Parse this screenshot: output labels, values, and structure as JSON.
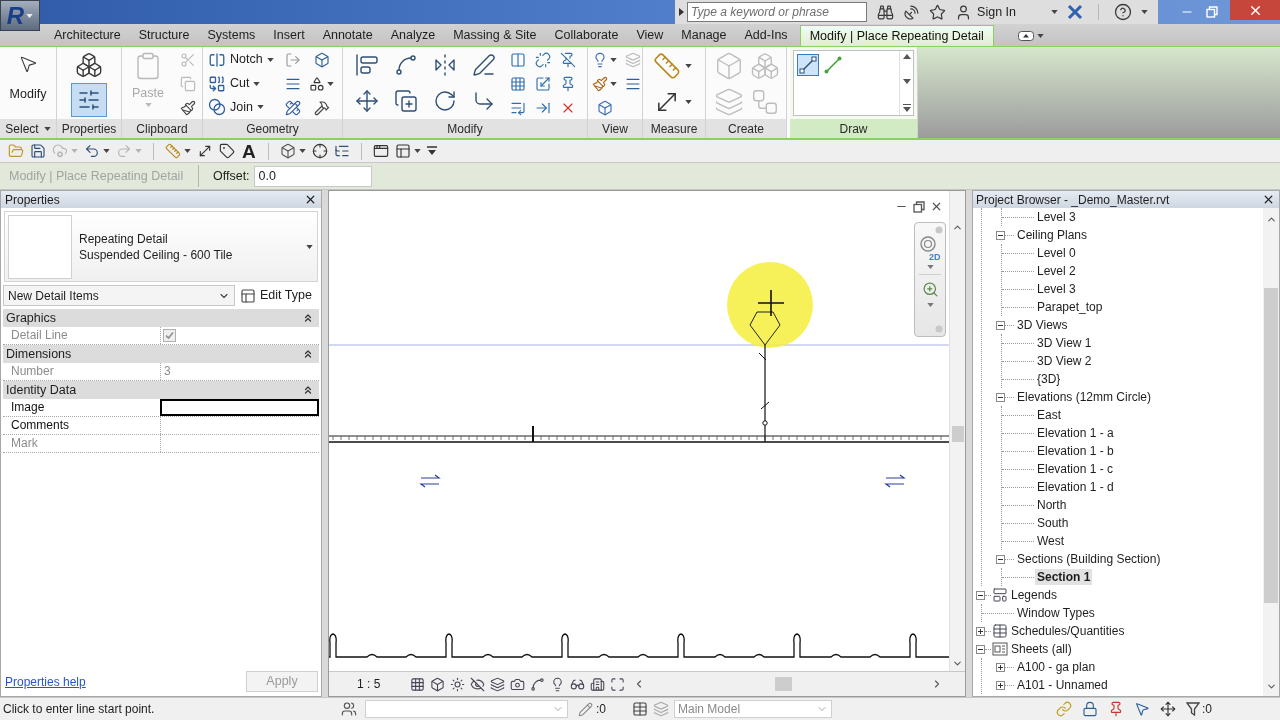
{
  "app_button": {
    "label": "R"
  },
  "title_bar": {
    "search": {
      "placeholder": "Type a keyword or phrase"
    },
    "sign_in": "Sign In"
  },
  "tabs": [
    {
      "label": "Architecture",
      "selected": false
    },
    {
      "label": "Structure",
      "selected": false
    },
    {
      "label": "Systems",
      "selected": false
    },
    {
      "label": "Insert",
      "selected": false
    },
    {
      "label": "Annotate",
      "selected": false
    },
    {
      "label": "Analyze",
      "selected": false
    },
    {
      "label": "Massing & Site",
      "selected": false
    },
    {
      "label": "Collaborate",
      "selected": false
    },
    {
      "label": "View",
      "selected": false
    },
    {
      "label": "Manage",
      "selected": false
    },
    {
      "label": "Add-Ins",
      "selected": false
    },
    {
      "label": "Modify | Place Repeating Detail",
      "selected": true
    }
  ],
  "ribbon": {
    "panels": [
      {
        "kind": "select",
        "label": "Select",
        "tools": [
          {
            "label": "Modify"
          }
        ]
      },
      {
        "kind": "properties",
        "label": "Properties",
        "tools": [
          {
            "selected": false
          },
          {
            "selected": true
          }
        ]
      },
      {
        "kind": "clipboard",
        "label": "Clipboard",
        "tools": [
          {
            "label": "Paste",
            "disabled": true
          },
          {
            "disabled": true
          },
          {
            "disabled": true
          },
          {
            "disabled": false
          }
        ]
      },
      {
        "kind": "geometry",
        "label": "Geometry",
        "tools": [
          {
            "label": "Notch"
          },
          {
            "label": "Cut"
          },
          {
            "label": "Join"
          }
        ]
      },
      {
        "kind": "modify",
        "label": "Modify"
      },
      {
        "kind": "view",
        "label": "View"
      },
      {
        "kind": "measure",
        "label": "Measure"
      },
      {
        "kind": "create",
        "label": "Create",
        "tools": [
          {
            "disabled": true
          },
          {
            "disabled": true
          },
          {
            "disabled": true
          },
          {
            "disabled": true
          }
        ]
      },
      {
        "kind": "draw",
        "label": "Draw",
        "tools": [
          {
            "selected": true
          },
          {
            "selected": false
          }
        ]
      }
    ]
  },
  "quick_access": [
    {
      "disabled": false
    },
    {
      "disabled": false
    },
    {
      "disabled": true
    },
    {
      "disabled": false
    },
    {
      "disabled": true
    },
    {
      "disabled": false
    },
    {
      "disabled": false
    },
    {
      "disabled": false
    },
    {
      "label": "A",
      "disabled": false
    },
    {
      "disabled": false
    },
    {
      "disabled": false
    },
    {
      "disabled": false
    },
    {
      "disabled": false
    },
    {
      "disabled": false
    },
    {
      "disabled": false
    }
  ],
  "options_bar": {
    "mode": "Modify | Place Repeating Detail",
    "offset": {
      "label": "Offset:",
      "value": "0.0"
    }
  },
  "properties": {
    "title": "Properties",
    "type_selector": {
      "family": "Repeating Detail",
      "type": "Suspended Ceiling - 600 Tile"
    },
    "instance_filter": "New Detail Items",
    "edit_type": "Edit Type",
    "groups": [
      {
        "label": "Graphics",
        "expanded": true,
        "params": [
          {
            "label": "Detail Line",
            "kind": "checkbox",
            "checked": true,
            "disabled": true,
            "focused": false
          }
        ]
      },
      {
        "label": "Dimensions",
        "expanded": true,
        "params": [
          {
            "label": "Number",
            "kind": "text",
            "value": "3",
            "disabled": true,
            "focused": false
          }
        ]
      },
      {
        "label": "Identity Data",
        "expanded": true,
        "params": [
          {
            "label": "Image",
            "kind": "text",
            "disabled": false,
            "focused": true
          },
          {
            "label": "Comments",
            "kind": "text",
            "disabled": false,
            "focused": false
          },
          {
            "label": "Mark",
            "kind": "text",
            "disabled": true,
            "focused": false
          }
        ]
      }
    ],
    "help_link": "Properties help",
    "apply": {
      "label": "Apply",
      "disabled": true
    }
  },
  "view": {
    "navigation_bar": {
      "wheel_badge": "2D"
    },
    "scale": "1 : 5"
  },
  "project_browser": {
    "title": "Project Browser - _Demo_Master.rvt",
    "tree": [
      {
        "children": [
          {
            "children": [
              {
                "label": "Level 3",
                "selected": false
              }
            ]
          },
          {
            "label": "Ceiling Plans",
            "expanded": true,
            "selected": false,
            "children": [
              {
                "label": "Level 0",
                "selected": false
              },
              {
                "label": "Level 2",
                "selected": false
              },
              {
                "label": "Level 3",
                "selected": false
              },
              {
                "label": "Parapet_top",
                "selected": false
              }
            ]
          },
          {
            "label": "3D Views",
            "expanded": true,
            "selected": false,
            "children": [
              {
                "label": "3D View 1",
                "selected": false
              },
              {
                "label": "3D View 2",
                "selected": false
              },
              {
                "label": "{3D}",
                "selected": false
              }
            ]
          },
          {
            "label": "Elevations (12mm Circle)",
            "expanded": true,
            "selected": false,
            "children": [
              {
                "label": "East",
                "selected": false
              },
              {
                "label": "Elevation 1 - a",
                "selected": false
              },
              {
                "label": "Elevation 1 - b",
                "selected": false
              },
              {
                "label": "Elevation 1 - c",
                "selected": false
              },
              {
                "label": "Elevation 1 - d",
                "selected": false
              },
              {
                "label": "North",
                "selected": false
              },
              {
                "label": "South",
                "selected": false
              },
              {
                "label": "West",
                "selected": false
              }
            ]
          },
          {
            "label": "Sections (Building Section)",
            "expanded": true,
            "selected": false,
            "children": [
              {
                "label": "Section 1",
                "selected": true
              }
            ]
          }
        ]
      },
      {
        "label": "Legends",
        "kind": "legends",
        "expanded": true,
        "selected": false,
        "children": [
          {
            "label": "Window Types",
            "selected": false
          }
        ]
      },
      {
        "label": "Schedules/Quantities",
        "kind": "schedules",
        "expanded": false,
        "selected": false
      },
      {
        "label": "Sheets (all)",
        "kind": "sheets",
        "expanded": true,
        "selected": false,
        "children": [
          {
            "label": "A100 - ga plan",
            "expanded": false,
            "selected": false
          },
          {
            "label": "A101 - Unnamed",
            "expanded": false,
            "selected": false
          }
        ]
      }
    ]
  },
  "status_bar": {
    "message": "Click to enter line start point.",
    "editable_count": ":0",
    "design_option": {
      "value": "Main Model",
      "disabled": true
    },
    "filter_count": ":0"
  }
}
